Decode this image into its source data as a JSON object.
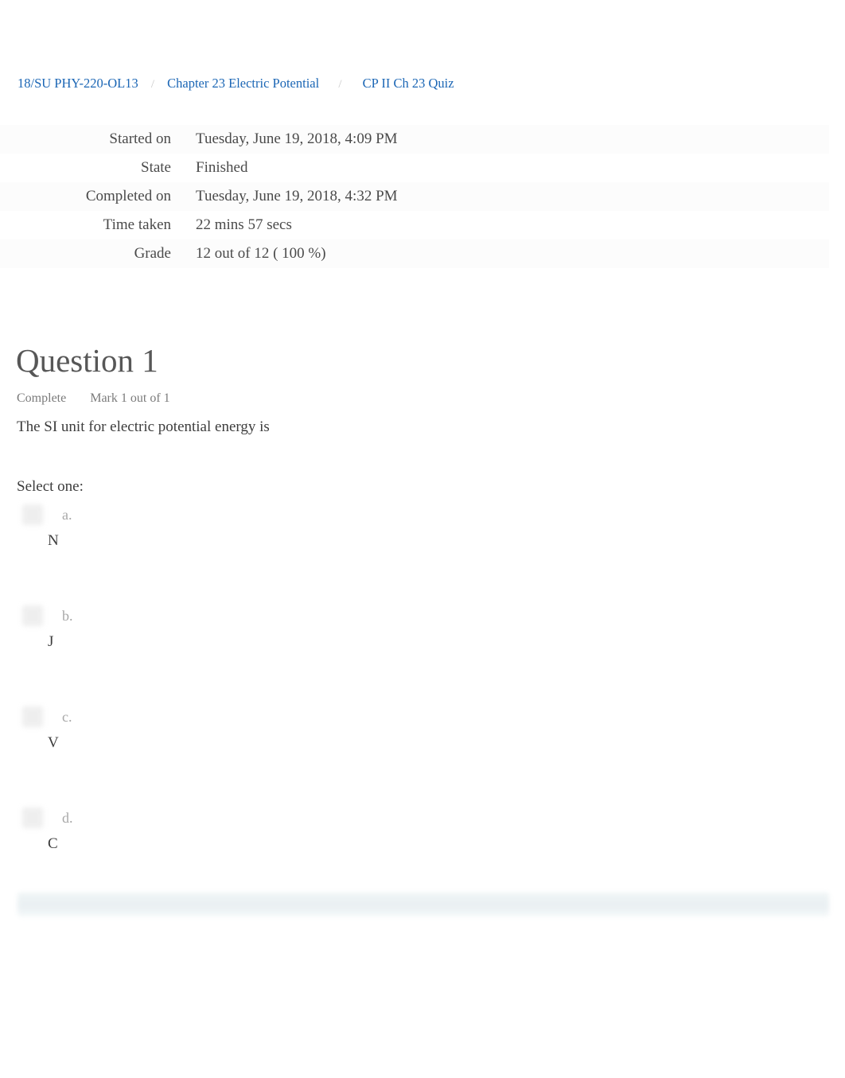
{
  "breadcrumb": {
    "separator": "/",
    "items": [
      {
        "label": "18/SU PHY-220-OL13"
      },
      {
        "label": "Chapter 23 Electric Potential"
      },
      {
        "label": "CP II Ch 23 Quiz"
      }
    ]
  },
  "quiz_info": {
    "rows": [
      {
        "label": "Started on",
        "value": "Tuesday, June 19, 2018, 4:09 PM"
      },
      {
        "label": "State",
        "value": "Finished"
      },
      {
        "label": "Completed on",
        "value": "Tuesday, June 19, 2018, 4:32 PM"
      },
      {
        "label": "Time taken",
        "value": "22 mins 57 secs"
      },
      {
        "label": "Grade",
        "value": "12  out of 12 (  100 %)"
      }
    ]
  },
  "question": {
    "heading": "Question 1",
    "state": "Complete",
    "mark": "Mark 1 out of 1",
    "text": "The SI unit for electric potential energy is",
    "select_prompt": "Select one:",
    "options": [
      {
        "letter": "a.",
        "text": "N"
      },
      {
        "letter": "b.",
        "text": "J"
      },
      {
        "letter": "c.",
        "text": "V"
      },
      {
        "letter": "d.",
        "text": "C"
      }
    ]
  },
  "colors": {
    "link": "#1b66b5",
    "heading": "#575757",
    "muted": "#7b7b7b",
    "body": "#3d3d3d",
    "feedback_bar": "#e7eef1"
  }
}
